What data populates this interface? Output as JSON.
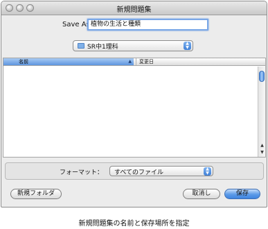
{
  "window": {
    "title": "新規問題集"
  },
  "save_as": {
    "label": "Save As:",
    "value": "植物の生活と種類"
  },
  "location": {
    "selected": "SR中1理科"
  },
  "browser": {
    "columns": [
      "名前",
      "変更日"
    ],
    "rows": []
  },
  "format": {
    "label": "フォーマット：",
    "selected": "すべてのファイル"
  },
  "buttons": {
    "new_folder": "新規フォルダ",
    "cancel": "取消し",
    "save": "保存"
  },
  "caption": "新規問題集の名前と保存場所を指定",
  "colors": {
    "accent": "#5b9ae8",
    "header_selected": "#5d95de"
  },
  "icons": {
    "folder": "folder-icon",
    "sort": "sort-ascending-icon",
    "popup": "popup-arrows-icon"
  }
}
